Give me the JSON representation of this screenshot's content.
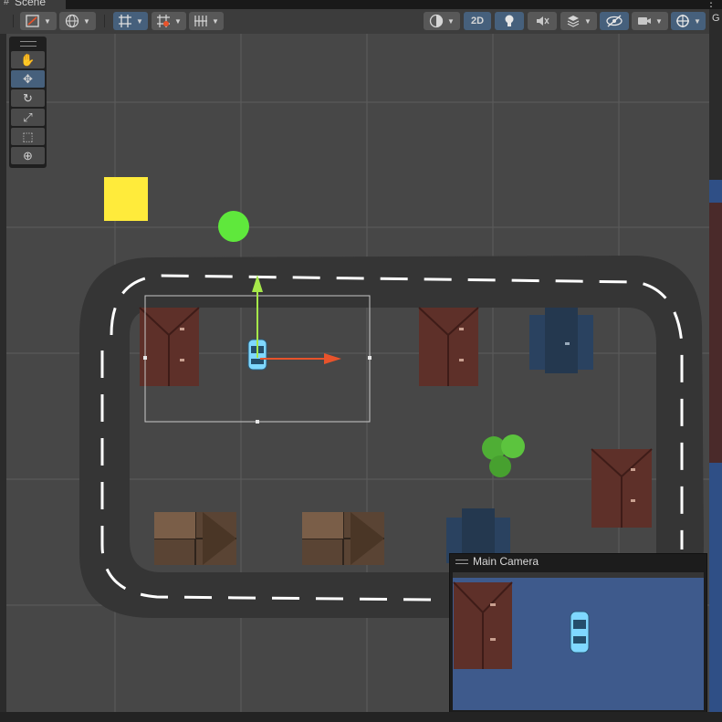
{
  "window": {
    "tab_label": "Scene",
    "tab_icon": "hash-icon",
    "side_label": "G"
  },
  "toolbar": {
    "buttons": [
      {
        "name": "draw-mode-icon"
      },
      {
        "name": "globe-icon"
      },
      {
        "name": "grid-snap-icon"
      },
      {
        "name": "grid-snap-increment-icon"
      },
      {
        "name": "ruler-grid-icon"
      },
      {
        "name": "shading-sphere-icon"
      },
      {
        "name": "2d-toggle",
        "label": "2D"
      },
      {
        "name": "lighting-bulb-icon"
      },
      {
        "name": "audio-mute-icon"
      },
      {
        "name": "effects-layers-icon"
      },
      {
        "name": "hidden-objects-eye-icon"
      },
      {
        "name": "camera-icon"
      },
      {
        "name": "gizmos-icon"
      }
    ]
  },
  "tools": [
    {
      "name": "hand-tool",
      "icon": "hand-icon",
      "glyph": "✋"
    },
    {
      "name": "move-tool",
      "icon": "move-arrows-icon",
      "glyph": "✥",
      "selected": true
    },
    {
      "name": "rotate-tool",
      "icon": "rotate-icon",
      "glyph": "↻"
    },
    {
      "name": "scale-tool",
      "icon": "scale-icon",
      "glyph": "⤢"
    },
    {
      "name": "rect-tool",
      "icon": "rect-icon",
      "glyph": "⬚"
    },
    {
      "name": "transform-tool",
      "icon": "transform-icon",
      "glyph": "⊕"
    }
  ],
  "camera_preview": {
    "title": "Main Camera"
  },
  "colors": {
    "scene_bg": "#474747",
    "road": "#353535",
    "lane_dash": "#ffffff",
    "yellow_square": "#ffeb3b",
    "green_circle": "#5fe83c",
    "gizmo_y": "#a6e84a",
    "gizmo_x": "#e8532b",
    "camera_bg": "#3e5a8c",
    "car": "#7fd8ff",
    "house_red": "#5e3029",
    "house_blue": "#2a4260",
    "house_brown": "#5a4434",
    "tree": "#4fae35"
  }
}
